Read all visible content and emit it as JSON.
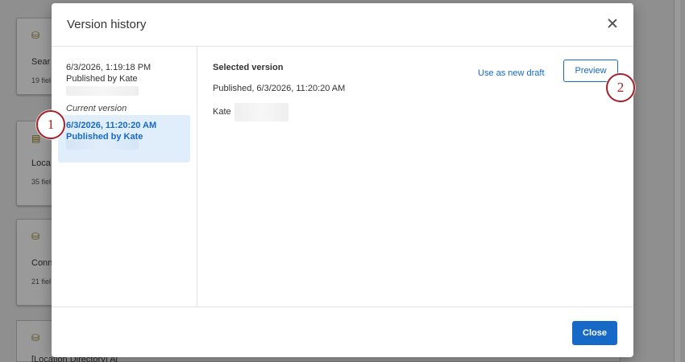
{
  "background": {
    "cards": [
      {
        "title": "Sear",
        "subtitle": "19 fiel"
      },
      {
        "title": "Loca",
        "subtitle": "35 fiel"
      },
      {
        "title": "Conn",
        "subtitle": "21 fiel"
      }
    ],
    "bottom_title": "[Location Directory] Al"
  },
  "modal": {
    "title": "Version history",
    "versions": [
      {
        "date": "6/3/2026, 1:19:18 PM",
        "published_by": "Published by Kate",
        "note": "Current version"
      },
      {
        "date": "6/3/2026, 11:20:20 AM",
        "published_by": "Published by Kate"
      }
    ],
    "selected": {
      "heading": "Selected version",
      "published": "Published, 6/3/2026, 11:20:20 AM",
      "user": "Kate"
    },
    "use_as_draft_label": "Use as new draft",
    "preview_label": "Preview",
    "close_label": "Close"
  },
  "callouts": [
    "1",
    "2"
  ],
  "colors": {
    "accent": "#1769c8",
    "callout": "#a4202b",
    "selected_bg": "#e0eefb"
  }
}
